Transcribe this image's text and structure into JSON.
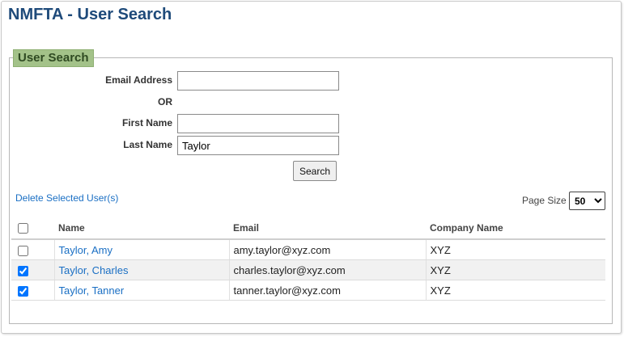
{
  "page": {
    "title": "NMFTA - User Search"
  },
  "search_form": {
    "legend": "User Search",
    "email_label": "Email Address",
    "email_value": "",
    "or_label": "OR",
    "first_name_label": "First Name",
    "first_name_value": "",
    "last_name_label": "Last Name",
    "last_name_value": "Taylor",
    "search_button": "Search"
  },
  "results": {
    "delete_link": "Delete Selected User(s)",
    "page_size_label": "Page Size",
    "page_size_value": "50",
    "columns": {
      "name": "Name",
      "email": "Email",
      "company": "Company Name"
    },
    "rows": [
      {
        "name": "Taylor, Amy",
        "email": "amy.taylor@xyz.com",
        "company": "XYZ",
        "checked": false
      },
      {
        "name": "Taylor, Charles",
        "email": "charles.taylor@xyz.com",
        "company": "XYZ",
        "checked": true
      },
      {
        "name": "Taylor, Tanner",
        "email": "tanner.taylor@xyz.com",
        "company": "XYZ",
        "checked": true
      }
    ]
  },
  "colors": {
    "title": "#1e4a7a",
    "legend_bg": "#a3c289",
    "link": "#1a6fc4"
  }
}
